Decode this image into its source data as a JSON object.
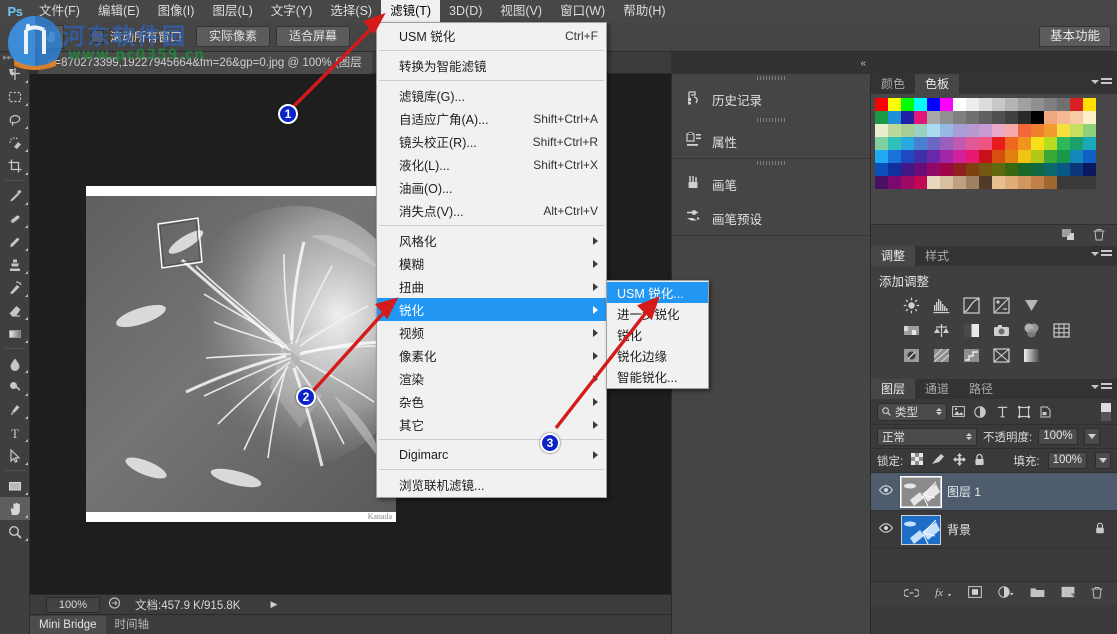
{
  "app": {
    "logo": "Ps",
    "workspace_button": "基本功能"
  },
  "menubar": {
    "items": [
      {
        "label": "文件(F)",
        "active": false
      },
      {
        "label": "编辑(E)",
        "active": false
      },
      {
        "label": "图像(I)",
        "active": false
      },
      {
        "label": "图层(L)",
        "active": false
      },
      {
        "label": "文字(Y)",
        "active": false
      },
      {
        "label": "选择(S)",
        "active": false
      },
      {
        "label": "滤镜(T)",
        "active": true
      },
      {
        "label": "3D(D)",
        "active": false
      },
      {
        "label": "视图(V)",
        "active": false
      },
      {
        "label": "窗口(W)",
        "active": false
      },
      {
        "label": "帮助(H)",
        "active": false
      }
    ]
  },
  "options_bar": {
    "checkbox_label": "滚动所有窗口",
    "checkbox_checked": false,
    "buttons": [
      "实际像素",
      "适合屏幕"
    ]
  },
  "document_tab": {
    "title": "u=870273399,19227945664&fm=26&gp=0.jpg @ 100% (图层"
  },
  "toolbar": {
    "tools": [
      {
        "name": "move-tool",
        "glyph": "move",
        "selected": false
      },
      {
        "name": "marquee-tool",
        "glyph": "marquee",
        "selected": false
      },
      {
        "name": "lasso-tool",
        "glyph": "lasso",
        "selected": false
      },
      {
        "name": "quick-selection-tool",
        "glyph": "quickselect",
        "selected": false
      },
      {
        "name": "crop-tool",
        "glyph": "crop",
        "selected": false
      },
      {
        "name": "eyedropper-tool",
        "glyph": "eyedropper",
        "selected": false
      },
      {
        "name": "healing-brush-tool",
        "glyph": "healing",
        "selected": false
      },
      {
        "name": "brush-tool",
        "glyph": "brush",
        "selected": false
      },
      {
        "name": "clone-stamp-tool",
        "glyph": "stamp",
        "selected": false
      },
      {
        "name": "history-brush-tool",
        "glyph": "historybrush",
        "selected": false
      },
      {
        "name": "eraser-tool",
        "glyph": "eraser",
        "selected": false
      },
      {
        "name": "gradient-tool",
        "glyph": "gradient",
        "selected": false
      },
      {
        "name": "blur-tool",
        "glyph": "blur",
        "selected": false
      },
      {
        "name": "dodge-tool",
        "glyph": "dodge",
        "selected": false
      },
      {
        "name": "pen-tool",
        "glyph": "pen",
        "selected": false
      },
      {
        "name": "type-tool",
        "glyph": "type",
        "selected": false
      },
      {
        "name": "path-selection-tool",
        "glyph": "pathselect",
        "selected": false
      },
      {
        "name": "rectangle-tool",
        "glyph": "rectangle",
        "selected": false
      },
      {
        "name": "hand-tool",
        "glyph": "hand",
        "selected": true
      },
      {
        "name": "zoom-tool",
        "glyph": "zoom",
        "selected": false
      }
    ]
  },
  "canvas": {
    "caption": "Kanada"
  },
  "status_bar": {
    "zoom": "100%",
    "doc_info": "文档:457.9 K/915.8K"
  },
  "bottom_tabs": [
    {
      "label": "Mini Bridge",
      "active": true
    },
    {
      "label": "时间轴",
      "active": false
    }
  ],
  "dock_icons": {
    "entries": [
      {
        "label": "历史记录",
        "icon": "history-icon"
      },
      {
        "label": "属性",
        "icon": "properties-icon"
      },
      {
        "label": "画笔",
        "icon": "brush-panel-icon"
      },
      {
        "label": "画笔预设",
        "icon": "brush-presets-icon"
      }
    ]
  },
  "color_panel": {
    "tabs": [
      {
        "label": "颜色",
        "active": false
      },
      {
        "label": "色板",
        "active": true
      }
    ],
    "swatch_rows": [
      [
        "#ff0000",
        "#ffff00",
        "#00ff00",
        "#00ffff",
        "#0000ff",
        "#ff00ff",
        "#ffffff",
        "#ededed",
        "#dcdcdc",
        "#c8c8c8",
        "#b4b4b4",
        "#a0a0a0",
        "#909090",
        "#808080",
        "#707070",
        "#d92121",
        "#ffe000"
      ],
      [
        "#1a9a44",
        "#1e90d8",
        "#2020a8",
        "#e01878",
        "#a8a8a8",
        "#909090",
        "#808080",
        "#707070",
        "#606060",
        "#505050",
        "#404040",
        "#2a2a2a",
        "#000000",
        "#f0a880",
        "#f5b891",
        "#f8cba6",
        "#fdf0c8"
      ],
      [
        "#e8efcf",
        "#bcd89a",
        "#a8cc96",
        "#9bd0c0",
        "#a9dcf0",
        "#95b8e4",
        "#a89fd8",
        "#b59ad2",
        "#c89ad2",
        "#e8a8c8",
        "#f4a8a8",
        "#f2683c",
        "#f08030",
        "#f29c30",
        "#f5e040",
        "#c8e060",
        "#8fd07a"
      ],
      [
        "#7fd0a0",
        "#2fc0b8",
        "#2aa8e0",
        "#4a80d0",
        "#6a68c4",
        "#9a5ec0",
        "#c05ab0",
        "#e05898",
        "#ee5480",
        "#e81c1c",
        "#f06820",
        "#f09420",
        "#f7e018",
        "#b8dc20",
        "#2fb85a",
        "#1aa06a",
        "#1ba8b8"
      ],
      [
        "#20a8f0",
        "#1a74d8",
        "#2048c0",
        "#4030a8",
        "#6a28a8",
        "#a028a8",
        "#d0209c",
        "#e81870",
        "#c81018",
        "#d85010",
        "#e08010",
        "#f0c410",
        "#b0c818",
        "#38a838",
        "#189848",
        "#1488b8",
        "#1060c8"
      ],
      [
        "#0a50b8",
        "#1030a0",
        "#401888",
        "#680d78",
        "#900868",
        "#a00448",
        "#902020",
        "#804010",
        "#705810",
        "#606810",
        "#386810",
        "#1a6828",
        "#106840",
        "#0a6868",
        "#085888",
        "#0a3878",
        "#0a1860"
      ],
      [
        "#4a1060",
        "#7a0a70",
        "#a00868",
        "#c00850",
        "#e8d8c0",
        "#d8c0a0",
        "#c0a080",
        "#a08060",
        "#503a28",
        "#e8c090",
        "#e0ac78",
        "#d09860",
        "#c08048",
        "#a06830",
        "#3a3a3a",
        "#3a3a3a",
        "#3a3a3a"
      ]
    ]
  },
  "adjustments_panel": {
    "tabs": [
      {
        "label": "调整",
        "active": true
      },
      {
        "label": "样式",
        "active": false
      }
    ],
    "title": "添加调整",
    "icons_row1": [
      "brightness-contrast-icon",
      "levels-icon",
      "curves-icon",
      "exposure-icon",
      "vibrance-icon"
    ],
    "icons_row2": [
      "hue-saturation-icon",
      "color-balance-icon",
      "black-white-icon",
      "photo-filter-icon",
      "channel-mixer-icon",
      "color-lookup-icon"
    ],
    "icons_row3": [
      "invert-icon",
      "posterize-icon",
      "threshold-icon",
      "selective-color-icon",
      "gradient-map-icon"
    ]
  },
  "layers_panel": {
    "tabs": [
      {
        "label": "图层",
        "active": true
      },
      {
        "label": "通道",
        "active": false
      },
      {
        "label": "路径",
        "active": false
      }
    ],
    "filter_label": "类型",
    "filter_icons": [
      "pixel-filter-icon",
      "adjustment-filter-icon",
      "type-filter-icon",
      "shape-filter-icon",
      "smartobject-filter-icon"
    ],
    "blend_mode": "正常",
    "opacity_label": "不透明度:",
    "opacity_value": "100%",
    "lock_label": "锁定:",
    "lock_icons": [
      "lock-transparent-icon",
      "lock-image-icon",
      "lock-position-icon",
      "lock-all-icon"
    ],
    "fill_label": "填充:",
    "fill_value": "100%",
    "layers": [
      {
        "name": "图层 1",
        "selected": true,
        "visible": true,
        "locked": false
      },
      {
        "name": "背景",
        "selected": false,
        "visible": true,
        "locked": true
      }
    ],
    "footer_icons": [
      "link-layers-icon",
      "layer-style-fx-icon",
      "add-mask-icon",
      "new-adjustment-icon",
      "new-group-icon",
      "new-layer-icon",
      "delete-layer-icon"
    ]
  },
  "filter_menu": {
    "items": [
      {
        "label": "USM 锐化",
        "shortcut": "Ctrl+F",
        "arrow": false,
        "highlight": false
      },
      {
        "sep": true
      },
      {
        "label": "转换为智能滤镜",
        "shortcut": "",
        "arrow": false,
        "highlight": false
      },
      {
        "sep": true
      },
      {
        "label": "滤镜库(G)...",
        "shortcut": "",
        "arrow": false,
        "highlight": false
      },
      {
        "label": "自适应广角(A)...",
        "shortcut": "Shift+Ctrl+A",
        "arrow": false,
        "highlight": false
      },
      {
        "label": "镜头校正(R)...",
        "shortcut": "Shift+Ctrl+R",
        "arrow": false,
        "highlight": false
      },
      {
        "label": "液化(L)...",
        "shortcut": "Shift+Ctrl+X",
        "arrow": false,
        "highlight": false
      },
      {
        "label": "油画(O)...",
        "shortcut": "",
        "arrow": false,
        "highlight": false
      },
      {
        "label": "消失点(V)...",
        "shortcut": "Alt+Ctrl+V",
        "arrow": false,
        "highlight": false
      },
      {
        "sep": true
      },
      {
        "label": "风格化",
        "shortcut": "",
        "arrow": true,
        "highlight": false
      },
      {
        "label": "模糊",
        "shortcut": "",
        "arrow": true,
        "highlight": false
      },
      {
        "label": "扭曲",
        "shortcut": "",
        "arrow": true,
        "highlight": false
      },
      {
        "label": "锐化",
        "shortcut": "",
        "arrow": true,
        "highlight": true
      },
      {
        "label": "视频",
        "shortcut": "",
        "arrow": true,
        "highlight": false
      },
      {
        "label": "像素化",
        "shortcut": "",
        "arrow": true,
        "highlight": false
      },
      {
        "label": "渲染",
        "shortcut": "",
        "arrow": true,
        "highlight": false
      },
      {
        "label": "杂色",
        "shortcut": "",
        "arrow": true,
        "highlight": false
      },
      {
        "label": "其它",
        "shortcut": "",
        "arrow": true,
        "highlight": false
      },
      {
        "sep": true
      },
      {
        "label": "Digimarc",
        "shortcut": "",
        "arrow": true,
        "highlight": false
      },
      {
        "sep": true
      },
      {
        "label": "浏览联机滤镜...",
        "shortcut": "",
        "arrow": false,
        "highlight": false
      }
    ]
  },
  "sharpen_submenu": {
    "items": [
      {
        "label": "USM 锐化...",
        "highlight": true
      },
      {
        "label": "进一步锐化",
        "highlight": false
      },
      {
        "label": "锐化",
        "highlight": false
      },
      {
        "label": "锐化边缘",
        "highlight": false
      },
      {
        "label": "智能锐化...",
        "highlight": false
      }
    ]
  },
  "callouts": [
    {
      "number": "1"
    },
    {
      "number": "2"
    },
    {
      "number": "3"
    }
  ],
  "watermark": {
    "site_name": "河东软件园",
    "url": "www.pc0359.cn"
  },
  "colors": {
    "accent_blue": "#2196f3",
    "badge_blue": "#0b23c8",
    "arrow_red": "#d51a1a",
    "panel_bg": "#3a3a3a",
    "menubar_bg": "#474747",
    "canvas_bg": "#1e1e1e"
  }
}
